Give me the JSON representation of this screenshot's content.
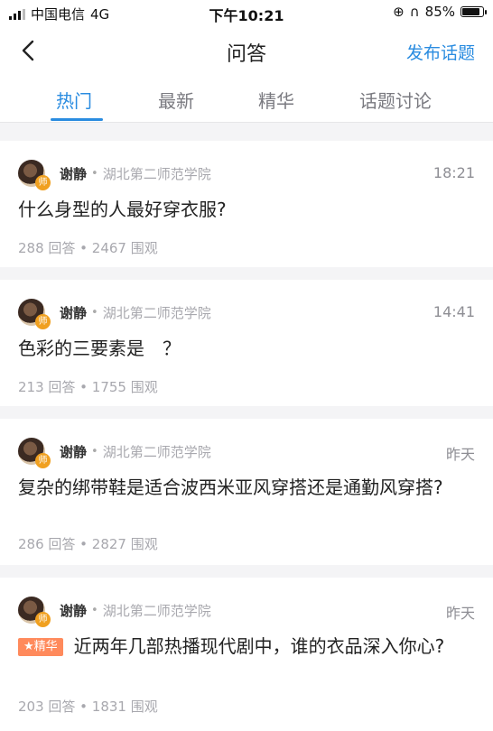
{
  "status_bar": {
    "carrier": "中国电信",
    "network": "4G",
    "time": "下午10:21",
    "battery": "85%",
    "battery_level": 0.85
  },
  "nav": {
    "back_icon": "chevron-left-icon",
    "title": "问答",
    "action_label": "发布话题"
  },
  "tabs": [
    {
      "label": "热门",
      "active": true
    },
    {
      "label": "最新",
      "active": false
    },
    {
      "label": "精华",
      "active": false
    },
    {
      "label": "话题讨论",
      "active": false
    }
  ],
  "posts": [
    {
      "author": "谢静",
      "badge": "师",
      "school": "湖北第二师范学院",
      "time": "18:21",
      "title": "什么身型的人最好穿衣服?",
      "stats": "288 回答 • 2467 围观"
    },
    {
      "author": "谢静",
      "badge": "师",
      "school": "湖北第二师范学院",
      "time": "14:41",
      "title": "色彩的三要素是　？",
      "stats": "213 回答 • 1755 围观"
    },
    {
      "author": "谢静",
      "badge": "师",
      "school": "湖北第二师范学院",
      "time": "昨天",
      "title": "复杂的绑带鞋是适合波西米亚风穿搭还是通勤风穿搭?",
      "stats": "286 回答 • 2827 围观"
    },
    {
      "author": "谢静",
      "badge": "师",
      "school": "湖北第二师范学院",
      "time": "昨天",
      "tag": "★精华",
      "title": "近两年几部热播现代剧中，谁的衣品深入你心?",
      "stats": "203 回答 • 1831 围观"
    }
  ],
  "colors": {
    "accent": "#2a8ce0",
    "tag": "#ff8a5c",
    "badge": "#f0a020"
  }
}
